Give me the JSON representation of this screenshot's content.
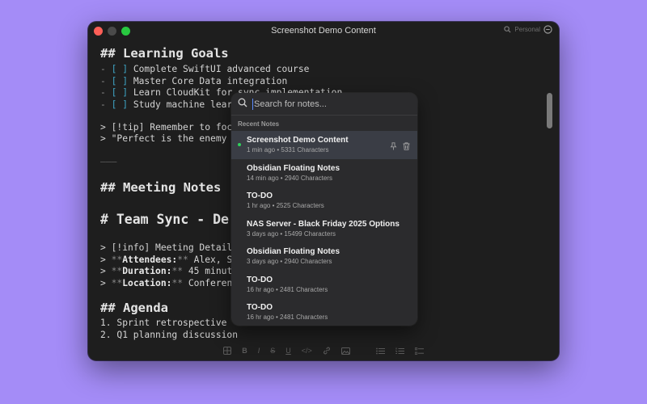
{
  "window": {
    "title": "Screenshot Demo Content",
    "workspace": "Personal"
  },
  "editor": {
    "lines": [
      "## Learning Goals",
      "- ",
      "[ ]",
      " Complete SwiftUI advanced course",
      "- ",
      "[ ]",
      " Master Core Data integration",
      "- ",
      "[ ]",
      " Learn CloudKit for sync implementation",
      "- ",
      "[ ]",
      " Study machine learni",
      "> [!tip] Remember to focus",
      "> \"Perfect is the enemy of",
      "___",
      "## Meeting Notes",
      "# Team Sync - De",
      "> [!info] Meeting Details",
      "> ",
      "**",
      "Attendees:",
      "**",
      " Alex, Sar",
      "> ",
      "**",
      "Duration:",
      "**",
      " 45 minutes",
      "> ",
      "**",
      "Location:",
      "**",
      " Conference",
      "## Agenda",
      "1. Sprint retrospective",
      "2. Q1 planning discussion"
    ]
  },
  "popup": {
    "search_placeholder": "Search for notes...",
    "section_label": "Recent Notes",
    "notes": [
      {
        "title": "Screenshot Demo Content",
        "meta": "1 min ago • 5331 Characters"
      },
      {
        "title": "Obsidian Floating Notes",
        "meta": "14 min ago • 2940 Characters"
      },
      {
        "title": "TO-DO",
        "meta": "1 hr ago • 2525 Characters"
      },
      {
        "title": "NAS Server - Black Friday 2025 Options",
        "meta": "3 days ago • 15499 Characters"
      },
      {
        "title": "Obsidian Floating Notes",
        "meta": "3 days ago • 2940 Characters"
      },
      {
        "title": "TO-DO",
        "meta": "16 hr ago • 2481 Characters"
      },
      {
        "title": "TO-DO",
        "meta": "16 hr ago • 2481 Characters"
      }
    ]
  },
  "toolbar": {
    "bold": "B",
    "italic": "I",
    "strike": "S",
    "underline": "U",
    "code": "</>"
  },
  "colors": {
    "background": "#a48cf7",
    "accent_checkbox": "#3fa6c7",
    "active_dot": "#2fd15b"
  }
}
